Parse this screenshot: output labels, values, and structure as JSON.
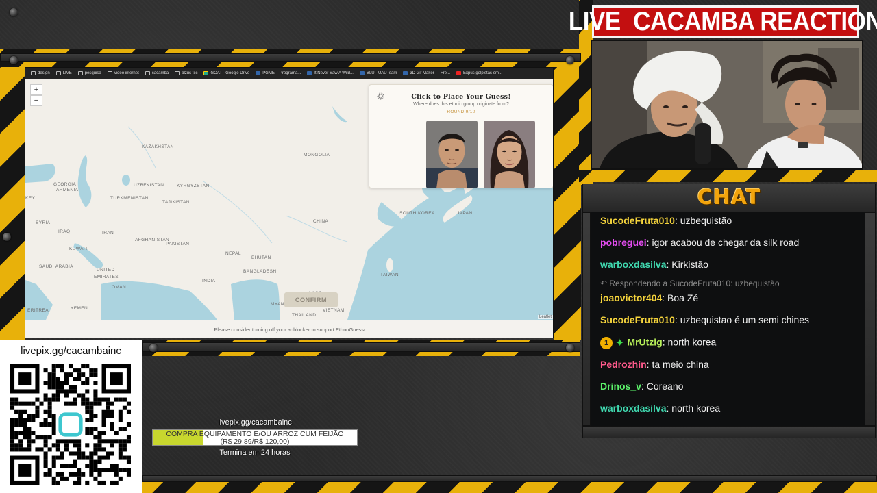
{
  "overlay": {
    "live_banner": "LIVE  CACAMBA REACTION",
    "chat_title": "CHAT",
    "livepix_url": "livepix.gg/cacambainc",
    "goal_label": "livepix.gg/cacambainc",
    "goal_text_1": "COMPRA EQUIPAMENTO E/OU ARROZ CUM FEIJÃO",
    "goal_text_2": "(R$ 29,89/R$ 120,00)",
    "goal_progress": 0.249,
    "goal_time": "Termina em 24 horas",
    "accent_yellow": "#e8b10a",
    "banner_red": "#c30f10"
  },
  "browser": {
    "bookmarks": [
      {
        "label": "design",
        "icon": "folder-icon"
      },
      {
        "label": "LIVE",
        "icon": "folder-icon"
      },
      {
        "label": "pesquisa",
        "icon": "folder-icon"
      },
      {
        "label": "video internet",
        "icon": "folder-icon"
      },
      {
        "label": "cacamba",
        "icon": "folder-icon"
      },
      {
        "label": "blzus tcc",
        "icon": "folder-icon"
      },
      {
        "label": "GOAT - Google Drive",
        "icon": "drive-icon"
      },
      {
        "label": "PGMEI - Programa...",
        "icon": "site-icon"
      },
      {
        "label": "It Never Saw A Wild...",
        "icon": "site-icon"
      },
      {
        "label": "BLU - UAUTeam",
        "icon": "site-icon"
      },
      {
        "label": "3D Gif Maker — Fre...",
        "icon": "site-icon"
      },
      {
        "label": "Expus golpistas em...",
        "icon": "youtube-icon"
      }
    ]
  },
  "game": {
    "panel_title": "Click to Place Your Guess!",
    "panel_question": "Where does this ethnic group originate from?",
    "round": "ROUND 9/10",
    "confirm_label": "CONFIRM",
    "attribution": "Leaflet",
    "adblock_notice": "Please consider turning off your adblocker to support EthnoGuessr",
    "zoom_in": "+",
    "zoom_out": "−",
    "countries": [
      {
        "name": "KAZAKHSTAN"
      },
      {
        "name": "MONGOLIA"
      },
      {
        "name": "GEORGIA"
      },
      {
        "name": "ARMENIA"
      },
      {
        "name": "UZBEKISTAN"
      },
      {
        "name": "KYRGYZSTAN"
      },
      {
        "name": "TURKMENISTAN"
      },
      {
        "name": "TAJIKISTAN"
      },
      {
        "name": "KEY"
      },
      {
        "name": "SOUTH KOREA"
      },
      {
        "name": "JAPAN"
      },
      {
        "name": "SYRIA"
      },
      {
        "name": "IRAQ"
      },
      {
        "name": "IRAN"
      },
      {
        "name": "CHINA"
      },
      {
        "name": "AFGHANISTAN"
      },
      {
        "name": "PAKISTAN"
      },
      {
        "name": "KUWAIT"
      },
      {
        "name": "NEPAL"
      },
      {
        "name": "BHUTAN"
      },
      {
        "name": "SAUDI ARABIA"
      },
      {
        "name": "BANGLADESH"
      },
      {
        "name": "UNITED"
      },
      {
        "name": "EMIRATES"
      },
      {
        "name": "OMAN"
      },
      {
        "name": "INDIA"
      },
      {
        "name": "TAIWAN"
      },
      {
        "name": "MYANMAR"
      },
      {
        "name": "YEMEN"
      },
      {
        "name": "ERITREA"
      },
      {
        "name": "THAILAND"
      },
      {
        "name": "VIETNAM"
      },
      {
        "name": "LAOS"
      }
    ]
  },
  "chat": {
    "messages": [
      {
        "user": "SucodeFruta010",
        "text": " uzbequistão",
        "color": "#f5d43c"
      },
      {
        "user": "pobreguei",
        "text": " igor acabou de chegar da silk road",
        "color": "#e34cf0"
      },
      {
        "user": "warboxdasilva",
        "text": " Kirkistão",
        "color": "#40d9b0"
      },
      {
        "user": "joaovictor404",
        "text": " Boa Zé",
        "color": "#f5d43c"
      },
      {
        "user": "SucodeFruta010",
        "text": " uzbequistao é um semi chines",
        "color": "#f5d43c"
      },
      {
        "user": "MrUtzig",
        "text": " north korea",
        "color": "#b9f25a"
      },
      {
        "user": "Pedrozhin",
        "text": " ta meio china",
        "color": "#ff5a8c"
      },
      {
        "user": "Drinos_v",
        "text": " Coreano",
        "color": "#5cf26a"
      },
      {
        "user": "warboxdasilva",
        "text": " north korea",
        "color": "#40d9b0"
      }
    ],
    "reply_note": "↶ Respondendo a SucodeFruta010: uzbequistão",
    "sub_badge": "1"
  }
}
